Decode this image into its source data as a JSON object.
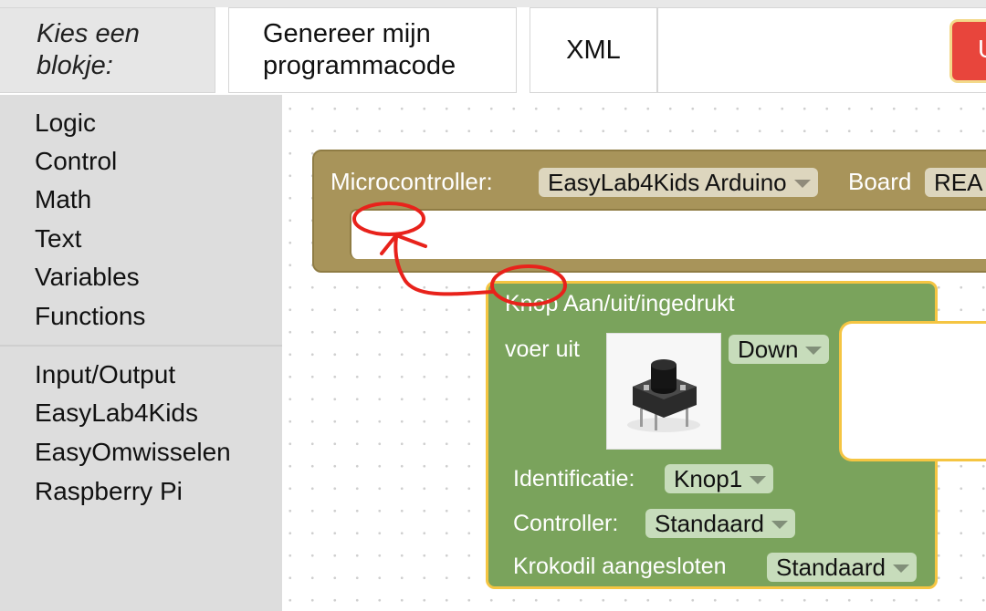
{
  "topbar": {
    "kies_label": "Kies een blokje:",
    "generate_label": "Genereer mijn programmacode",
    "xml_label": "XML",
    "red_button_label": "U"
  },
  "toolbox": {
    "categories": [
      "Logic",
      "Control",
      "Math",
      "Text",
      "Variables",
      "Functions"
    ],
    "extensions": [
      "Input/Output",
      "EasyLab4Kids",
      "EasyOmwisselen",
      "Raspberry Pi"
    ]
  },
  "micro_block": {
    "label": "Microcontroller:",
    "board_select": "EasyLab4Kids Arduino",
    "board_label": "Board",
    "board_value": "REA"
  },
  "knop_block": {
    "title": "Knop Aan/uit/ingedrukt",
    "do_label": "voer uit",
    "state_select": "Down",
    "image_name": "pushbutton-image",
    "id_label": "Identificatie:",
    "id_value": "Knop1",
    "controller_label": "Controller:",
    "controller_value": "Standaard",
    "crocodile_label": "Krokodil aangesloten",
    "crocodile_value": "Standaard"
  },
  "colors": {
    "micro_block": "#a8945a",
    "knop_block": "#7aa35c",
    "knop_highlight": "#f5c542",
    "annotation": "#e8221b",
    "red_button": "#e8453c"
  }
}
